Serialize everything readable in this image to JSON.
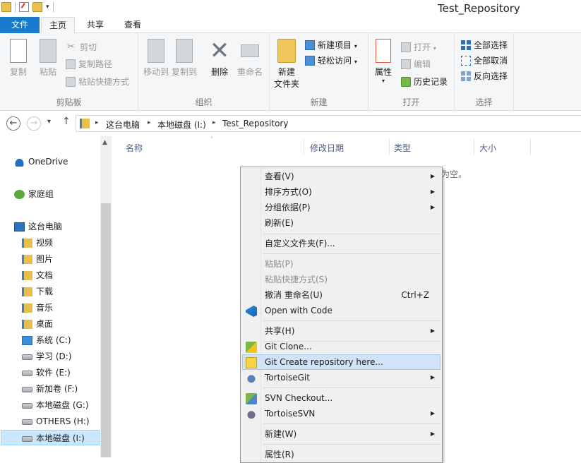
{
  "window": {
    "title": "Test_Repository"
  },
  "ribbon_tabs": {
    "file": "文件",
    "home": "主页",
    "share": "共享",
    "view": "查看"
  },
  "ribbon": {
    "clipboard": {
      "label": "剪贴板",
      "copy": "复制",
      "paste": "粘贴",
      "cut": "剪切",
      "copy_path": "复制路径",
      "paste_shortcut": "粘贴快捷方式"
    },
    "organize": {
      "label": "组织",
      "move_to": "移动到",
      "copy_to": "复制到",
      "delete": "删除",
      "rename": "重命名"
    },
    "new": {
      "label": "新建",
      "new_folder_line1": "新建",
      "new_folder_line2": "文件夹",
      "new_item": "新建项目",
      "easy_access": "轻松访问"
    },
    "open": {
      "label": "打开",
      "properties": "属性",
      "open": "打开",
      "edit": "编辑",
      "history": "历史记录"
    },
    "select": {
      "label": "选择",
      "select_all": "全部选择",
      "select_none": "全部取消",
      "invert": "反向选择"
    }
  },
  "address": {
    "crumbs": [
      "这台电脑",
      "本地磁盘 (I:)",
      "Test_Repository"
    ]
  },
  "nav_pane": {
    "onedrive": "OneDrive",
    "homegroup": "家庭组",
    "this_pc": "这台电脑",
    "items": [
      "视频",
      "图片",
      "文档",
      "下载",
      "音乐",
      "桌面"
    ],
    "drives": [
      "系统 (C:)",
      "学习 (D:)",
      "软件 (E:)",
      "新加卷 (F:)",
      "本地磁盘 (G:)",
      "OTHERS (H:)",
      "本地磁盘 (I:)"
    ]
  },
  "columns": {
    "name": "名称",
    "modified": "修改日期",
    "type": "类型",
    "size": "大小"
  },
  "empty_message": "为空。",
  "context_menu": {
    "view": "查看(V)",
    "sort_by": "排序方式(O)",
    "group_by": "分组依据(P)",
    "refresh": "刷新(E)",
    "customize": "自定义文件夹(F)...",
    "paste": "粘贴(P)",
    "paste_shortcut": "粘贴快捷方式(S)",
    "undo_rename": "撤消 重命名(U)",
    "undo_shortcut": "Ctrl+Z",
    "open_with_code": "Open with Code",
    "share": "共享(H)",
    "git_clone": "Git Clone...",
    "git_create": "Git Create repository here...",
    "tortoise_git": "TortoiseGit",
    "svn_checkout": "SVN Checkout...",
    "tortoise_svn": "TortoiseSVN",
    "new": "新建(W)",
    "properties": "属性(R)"
  }
}
